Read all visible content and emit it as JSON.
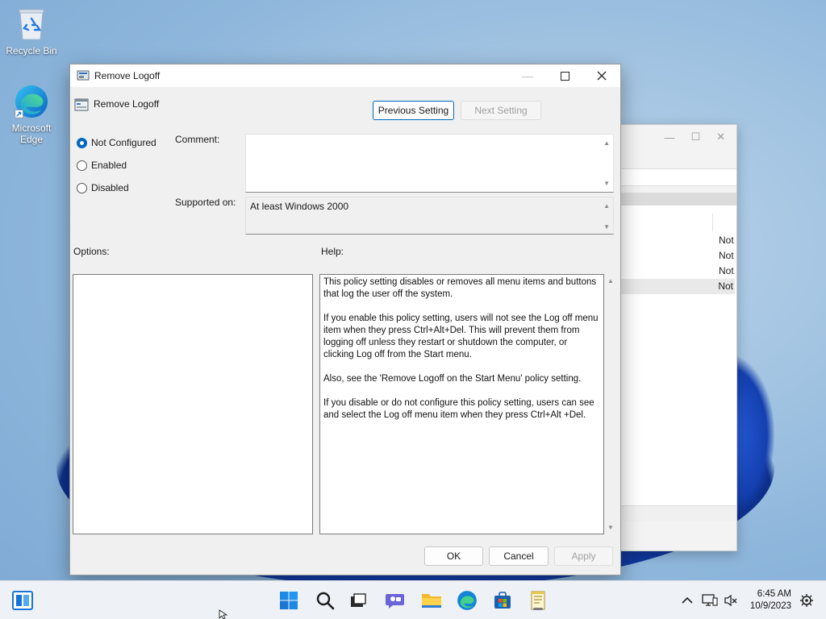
{
  "desktop": {
    "icons": [
      {
        "label": "Recycle Bin",
        "icon": "recycle-bin-icon"
      },
      {
        "label": "Microsoft Edge",
        "icon": "edge-icon"
      }
    ]
  },
  "background_window": {
    "rows": [
      "Not",
      "Not",
      "Not",
      "Not"
    ]
  },
  "dialog": {
    "title": "Remove Logoff",
    "policy_name": "Remove Logoff",
    "buttons": {
      "previous": "Previous Setting",
      "next": "Next Setting",
      "ok": "OK",
      "cancel": "Cancel",
      "apply": "Apply"
    },
    "state_options": [
      {
        "label": "Not Configured",
        "selected": true
      },
      {
        "label": "Enabled",
        "selected": false
      },
      {
        "label": "Disabled",
        "selected": false
      }
    ],
    "comment_label": "Comment:",
    "comment_value": "",
    "supported_on_label": "Supported on:",
    "supported_on_value": "At least Windows 2000",
    "options_label": "Options:",
    "help_label": "Help:",
    "help_text": "This policy setting disables or removes all menu items and buttons that log the user off the system.\n\nIf you enable this policy setting, users will not see the Log off menu item when they press Ctrl+Alt+Del. This will prevent them from logging off unless they restart or shutdown the computer, or clicking Log off from the Start menu.\n\nAlso, see the 'Remove Logoff on the Start Menu' policy setting.\n\nIf you disable or do not configure this policy setting, users can see and select the Log off menu item when they press Ctrl+Alt +Del."
  },
  "taskbar": {
    "apps": [
      "start-icon",
      "search-icon",
      "task-view-icon",
      "chat-icon",
      "file-explorer-icon",
      "edge-icon",
      "store-icon",
      "notepad-icon"
    ],
    "time": "6:45 AM",
    "date": "10/9/2023"
  },
  "colors": {
    "accent": "#0067c0",
    "taskbar": "#eef1f6"
  }
}
